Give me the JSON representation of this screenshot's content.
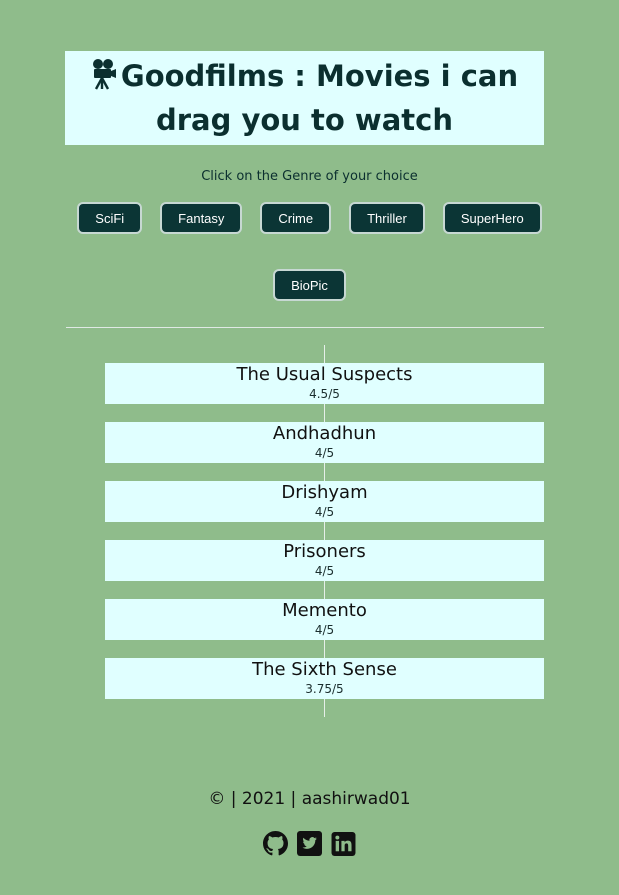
{
  "header": {
    "title": "Goodfilms : Movies i can drag you to watch",
    "icon": "movie-camera-icon"
  },
  "instruction": "Click on the Genre of your choice",
  "genres": [
    {
      "label": "SciFi"
    },
    {
      "label": "Fantasy"
    },
    {
      "label": "Crime"
    },
    {
      "label": "Thriller"
    },
    {
      "label": "SuperHero"
    },
    {
      "label": "BioPic"
    }
  ],
  "movies": [
    {
      "name": "The Usual Suspects",
      "rating": "4.5/5"
    },
    {
      "name": "Andhadhun",
      "rating": "4/5"
    },
    {
      "name": "Drishyam",
      "rating": "4/5"
    },
    {
      "name": "Prisoners",
      "rating": "4/5"
    },
    {
      "name": "Memento",
      "rating": "4/5"
    },
    {
      "name": "The Sixth Sense",
      "rating": "3.75/5"
    }
  ],
  "footer": {
    "text": "© | 2021 | aashirwad01"
  },
  "socials": [
    {
      "icon": "github-icon"
    },
    {
      "icon": "twitter-icon"
    },
    {
      "icon": "linkedin-icon"
    }
  ],
  "colors": {
    "background": "#8fbc8b",
    "card": "#e0ffff",
    "button": "#0b3535",
    "text": "#0b2f2f"
  }
}
